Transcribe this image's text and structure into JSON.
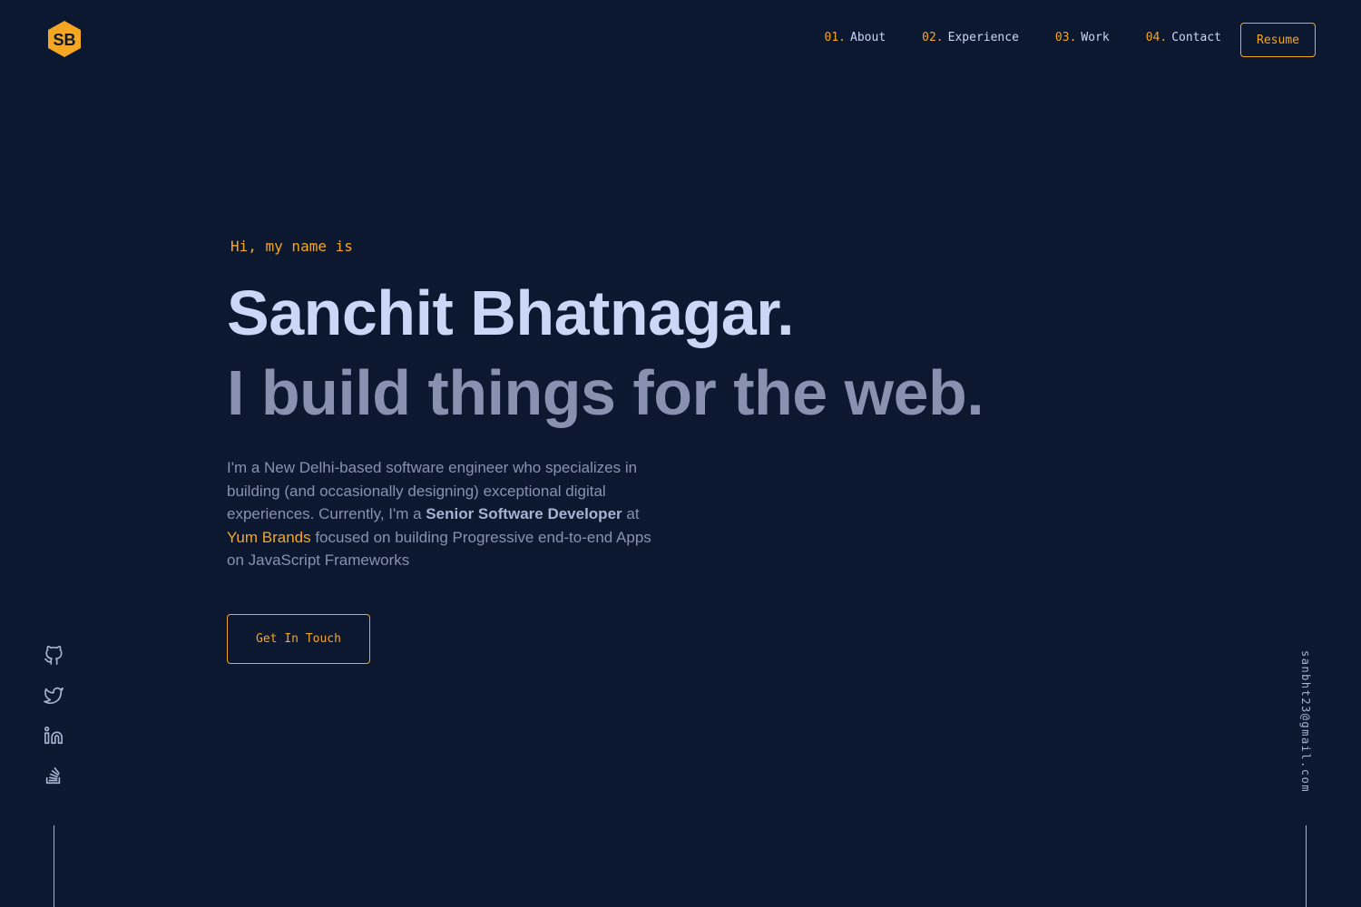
{
  "brand": {
    "logo_text": "SB",
    "accent_color": "#f5a623",
    "background_color": "#0b1830"
  },
  "nav": {
    "items": [
      {
        "num": "01.",
        "label": "About"
      },
      {
        "num": "02.",
        "label": "Experience"
      },
      {
        "num": "03.",
        "label": "Work"
      },
      {
        "num": "04.",
        "label": "Contact"
      }
    ],
    "resume_label": "Resume"
  },
  "hero": {
    "greeting": "Hi, my name is",
    "name": "Sanchit Bhatnagar.",
    "tagline": "I build things for the web.",
    "bio": {
      "part1": "I'm a New Delhi-based software engineer who specializes in building (and occasionally designing) exceptional digital experiences. Currently, I'm a ",
      "role": "Senior Software Developer",
      "part2": " at ",
      "company": "Yum Brands",
      "part3": " focused on building Progressive end-to-end Apps on JavaScript Frameworks"
    },
    "cta_label": "Get In Touch"
  },
  "social": {
    "icons": [
      "github-icon",
      "twitter-icon",
      "linkedin-icon",
      "stackoverflow-icon"
    ]
  },
  "email": "sanbht23@gmail.com"
}
